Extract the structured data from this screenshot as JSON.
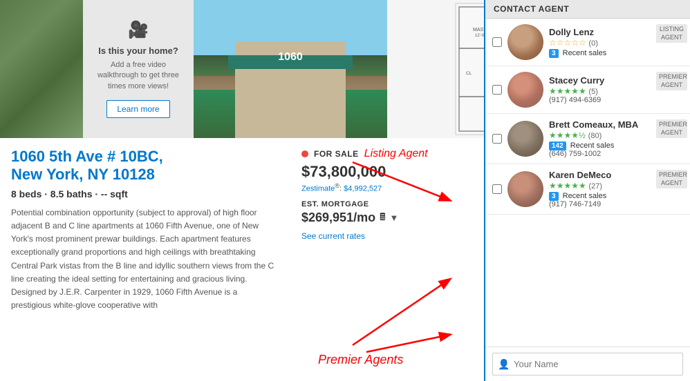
{
  "top": {
    "overlay": {
      "title": "Is this your home?",
      "description": "Add a free video walkthrough to get three times more views!",
      "learn_more": "Learn more"
    },
    "building_number": "1060"
  },
  "property": {
    "address_line1": "1060 5th Ave # 10BC,",
    "address_line2": "New York, NY 10128",
    "specs": "8 beds · 8.5 baths · -- sqft",
    "description": "Potential combination opportunity (subject to approval) of high floor adjacent B and C line apartments at 1060 Fifth Avenue, one of New York's most prominent prewar buildings. Each apartment features exceptionally grand proportions and high ceilings with breathtaking Central Park vistas from the B line and idyllic southern views from the C line creating the ideal setting for entertaining and gracious living. Designed by J.E.R. Carpenter in 1929, 1060 Fifth Avenue is a prestigious white-glove cooperative with",
    "for_sale": "FOR SALE",
    "listing_agent_label": "Listing Agent",
    "price": "$73,800,000",
    "zestimate_label": "Zestimate",
    "zestimate_value": "$4,992,527",
    "est_mortgage_label": "EST. MORTGAGE",
    "mortgage_amount": "$269,951/mo",
    "see_rates": "See current rates",
    "premier_agents_label": "Premier Agents"
  },
  "contact_agent": {
    "header": "CONTACT AGENT",
    "agents": [
      {
        "name": "Dolly Lenz",
        "stars": "☆☆☆☆☆",
        "star_type": "empty",
        "rating": "(0)",
        "sales_count": "3",
        "sales_label": "Recent sales",
        "tag_line1": "LISTING",
        "tag_line2": "AGENT",
        "is_listing": true
      },
      {
        "name": "Stacey Curry",
        "stars": "★★★★★",
        "star_type": "filled_green",
        "rating": "(5)",
        "phone": "(917) 494-6369",
        "tag_line1": "PREMIER",
        "tag_line2": "AGENT"
      },
      {
        "name": "Brett Comeaux, MBA",
        "stars": "★★★★½",
        "star_type": "filled_green",
        "rating": "(80)",
        "sales_count": "142",
        "sales_label": "Recent sales",
        "phone": "(646) 759-1002",
        "tag_line1": "PREMIER",
        "tag_line2": "AGENT"
      },
      {
        "name": "Karen DeMeco",
        "stars": "★★★★★",
        "star_type": "filled_green",
        "rating": "(27)",
        "sales_count": "3",
        "sales_label": "Recent sales",
        "phone": "(917) 746-7149",
        "tag_line1": "PREMIER",
        "tag_line2": "AGENT"
      }
    ],
    "your_name_placeholder": "Your Name"
  }
}
